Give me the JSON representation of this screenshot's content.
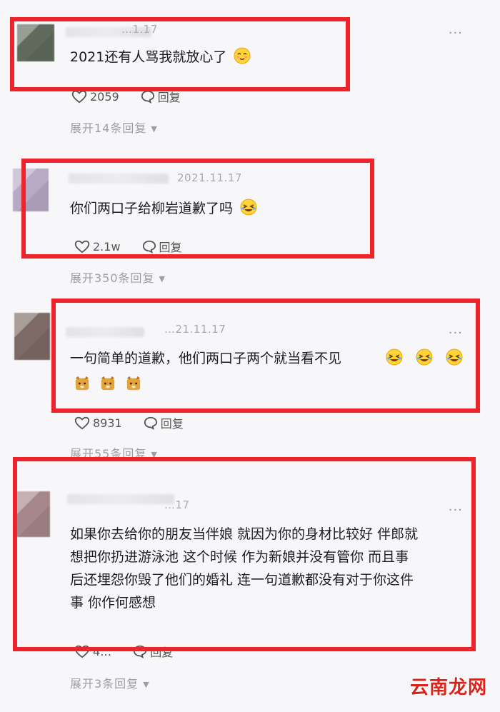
{
  "comments": [
    {
      "date": "…1.17",
      "text": "2021还有人骂我就放心了",
      "likes": "2059",
      "reply_label": "回复",
      "expand": "展开14条回复",
      "more": "···"
    },
    {
      "date": "2021.11.17",
      "text": "你们两口子给柳岩道歉了吗",
      "likes": "2.1w",
      "reply_label": "回复",
      "expand": "展开350条回复"
    },
    {
      "date": "…21.11.17",
      "text": "一句简单的道歉，他们两口子两个就当看不见",
      "likes": "8931",
      "reply_label": "回复",
      "expand": "展开55条回复",
      "more": "···"
    },
    {
      "date": "…17",
      "text_lines": [
        "如果你去给你的朋友当伴娘 就因为你的身材比较好 伴郎就",
        "想把你扔进游泳池 这个时候 作为新娘并没有管你 而且事",
        "后还埋怨你毁了他们的婚礼 连一句道歉都没有对于你这件",
        "事 你作何感想"
      ],
      "likes": "4…",
      "reply_label": "回复",
      "expand": "展开3条回复",
      "more": "···"
    }
  ],
  "highlight_color": "#f0232b",
  "watermark": "云南龙网"
}
